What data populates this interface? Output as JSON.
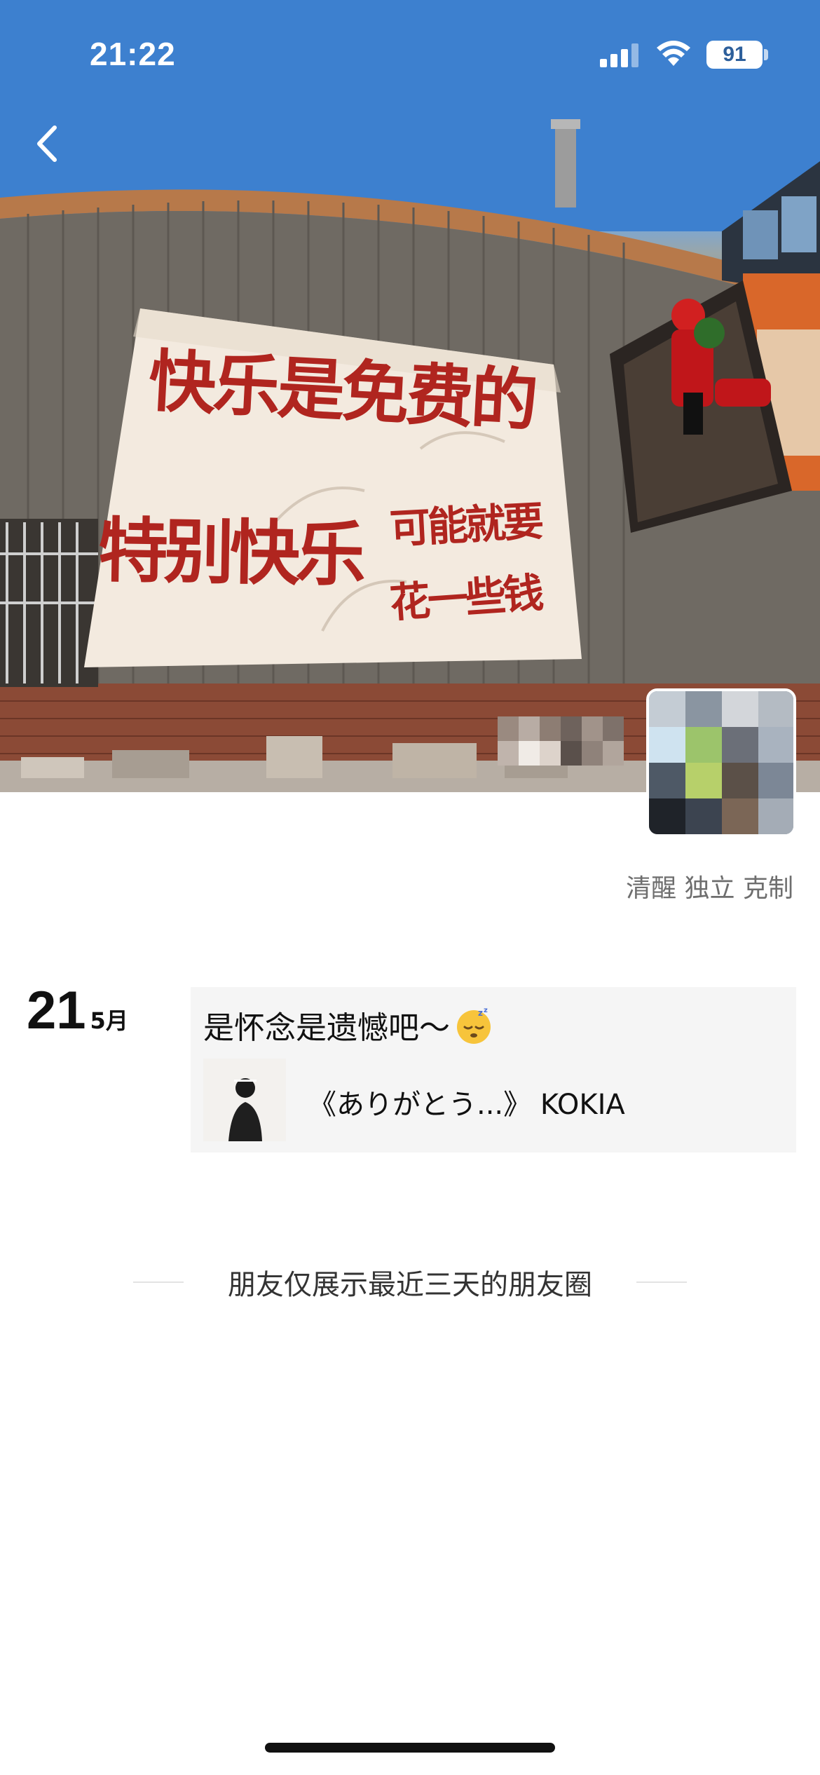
{
  "status_bar": {
    "time": "21:22",
    "battery_level": "91"
  },
  "cover": {
    "banner_line1": "快乐是免费的",
    "banner_line2": "特别快乐",
    "banner_line3a": "可能就要",
    "banner_line3b": "花一些钱"
  },
  "profile": {
    "signature": "清醒 独立 克制"
  },
  "post": {
    "day": "21",
    "month": "5月",
    "text": "是怀念是遗憾吧～",
    "emoji": "sleepy-face-emoji",
    "music_title": "《ありがとう...》 KOKIA"
  },
  "footer": {
    "note": "朋友仅展示最近三天的朋友圈"
  },
  "colors": {
    "sky": "#2f74c9",
    "banner_text": "#b0251f",
    "card_bg": "#f5f5f5",
    "signature_text": "#6e6e6e"
  }
}
